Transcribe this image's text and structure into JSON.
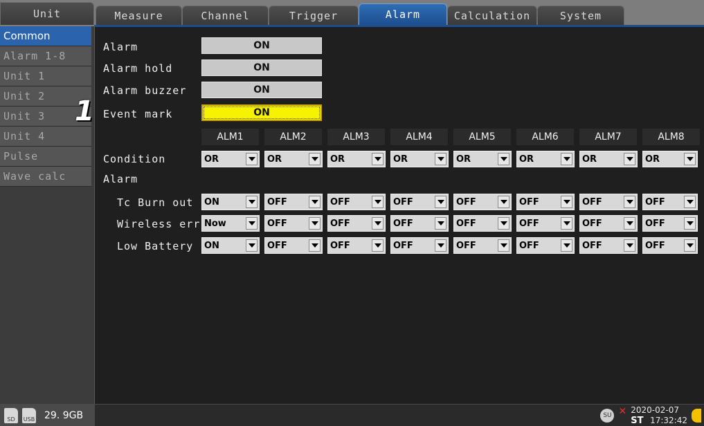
{
  "tabs": [
    {
      "label": "Unit"
    },
    {
      "label": "Measure"
    },
    {
      "label": "Channel"
    },
    {
      "label": "Trigger"
    },
    {
      "label": "Alarm"
    },
    {
      "label": "Calculation"
    },
    {
      "label": "System"
    }
  ],
  "sidebar": {
    "items": [
      {
        "label": "Common"
      },
      {
        "label": "Alarm 1-8"
      },
      {
        "label": "Unit 1"
      },
      {
        "label": "Unit 2"
      },
      {
        "label": "Unit 3"
      },
      {
        "label": "Unit 4"
      },
      {
        "label": "Pulse"
      },
      {
        "label": "Wave calc"
      }
    ]
  },
  "settings": {
    "alarm": {
      "label": "Alarm",
      "value": "ON"
    },
    "alarm_hold": {
      "label": "Alarm hold",
      "value": "ON"
    },
    "alarm_buzzer": {
      "label": "Alarm buzzer",
      "value": "ON"
    },
    "event_mark": {
      "label": "Event mark",
      "value": "ON"
    }
  },
  "marker": "1",
  "columns": [
    "ALM1",
    "ALM2",
    "ALM3",
    "ALM4",
    "ALM5",
    "ALM6",
    "ALM7",
    "ALM8"
  ],
  "condition": {
    "label": "Condition",
    "values": [
      "OR",
      "OR",
      "OR",
      "OR",
      "OR",
      "OR",
      "OR",
      "OR"
    ]
  },
  "alarm_section_label": "Alarm",
  "rows": [
    {
      "label": "Tc Burn out",
      "values": [
        "ON",
        "OFF",
        "OFF",
        "OFF",
        "OFF",
        "OFF",
        "OFF",
        "OFF"
      ]
    },
    {
      "label": "Wireless err",
      "values": [
        "Now",
        "OFF",
        "OFF",
        "OFF",
        "OFF",
        "OFF",
        "OFF",
        "OFF"
      ]
    },
    {
      "label": "Low Battery",
      "values": [
        "ON",
        "OFF",
        "OFF",
        "OFF",
        "OFF",
        "OFF",
        "OFF",
        "OFF"
      ]
    }
  ],
  "status": {
    "sd_label": "SD",
    "usb_label": "USB",
    "storage": "29. 9GB",
    "unit_icon_label": "SU",
    "st_label": "ST",
    "date": "2020-02-07",
    "time": "17:32:42"
  },
  "colors": {
    "active_tab": "#1d4f8e",
    "selected_field": "#f7f200",
    "background": "#1e1e1e"
  }
}
